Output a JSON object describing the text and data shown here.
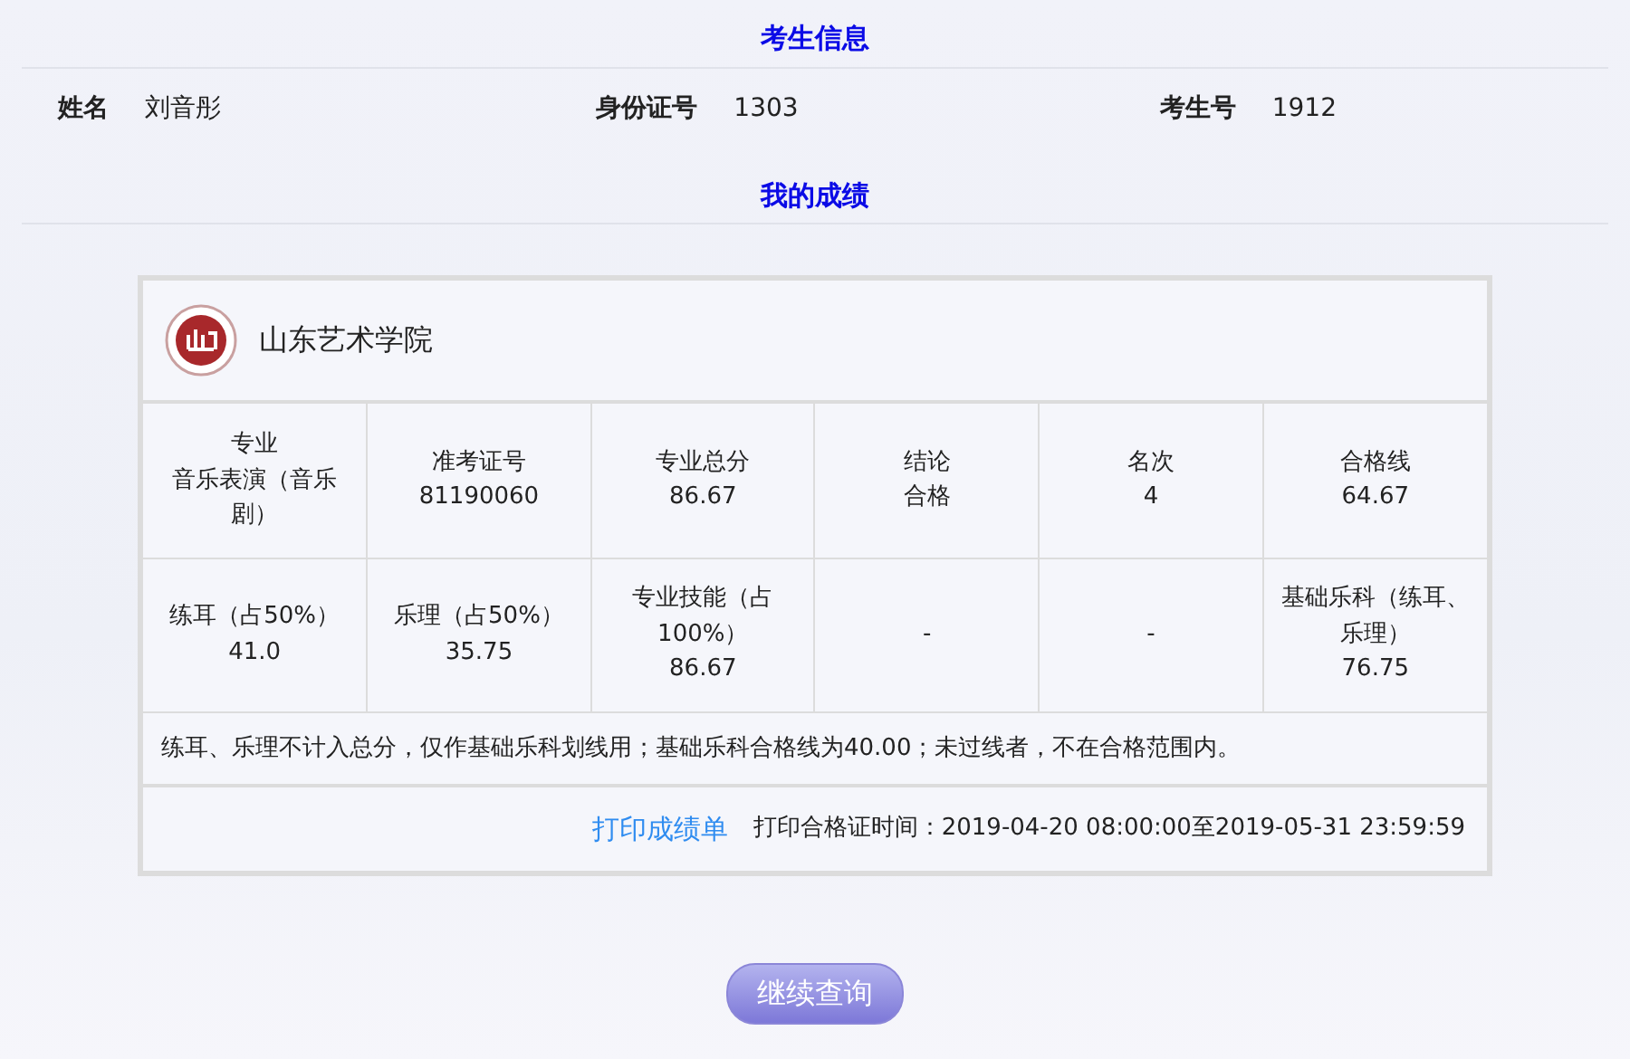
{
  "candidate_info": {
    "title": "考生信息",
    "fields": [
      {
        "label": "姓名",
        "value": "刘音彤"
      },
      {
        "label": "身份证号",
        "value": "1303"
      },
      {
        "label": "考生号",
        "value": "1912"
      }
    ]
  },
  "scores": {
    "title": "我的成绩",
    "school": "山东艺术学院",
    "rows": [
      [
        {
          "label": "专业",
          "value": "音乐表演（音乐剧）"
        },
        {
          "label": "准考证号",
          "value": "81190060"
        },
        {
          "label": "专业总分",
          "value": "86.67"
        },
        {
          "label": "结论",
          "value": "合格"
        },
        {
          "label": "名次",
          "value": "4"
        },
        {
          "label": "合格线",
          "value": "64.67"
        }
      ],
      [
        {
          "label": "练耳（占50%）",
          "value": "41.0"
        },
        {
          "label": "乐理（占50%）",
          "value": "35.75"
        },
        {
          "label": "专业技能（占100%）",
          "value": "86.67"
        },
        {
          "value": "-"
        },
        {
          "value": "-"
        },
        {
          "label": "基础乐科（练耳、乐理）",
          "value": "76.75"
        }
      ]
    ],
    "note": "练耳、乐理不计入总分，仅作基础乐科划线用；基础乐科合格线为40.00；未过线者，不在合格范围内。",
    "print_link": "打印成绩单",
    "print_time": "打印合格证时间：2019-04-20 08:00:00至2019-05-31 23:59:59"
  },
  "continue_button": "继续查询"
}
